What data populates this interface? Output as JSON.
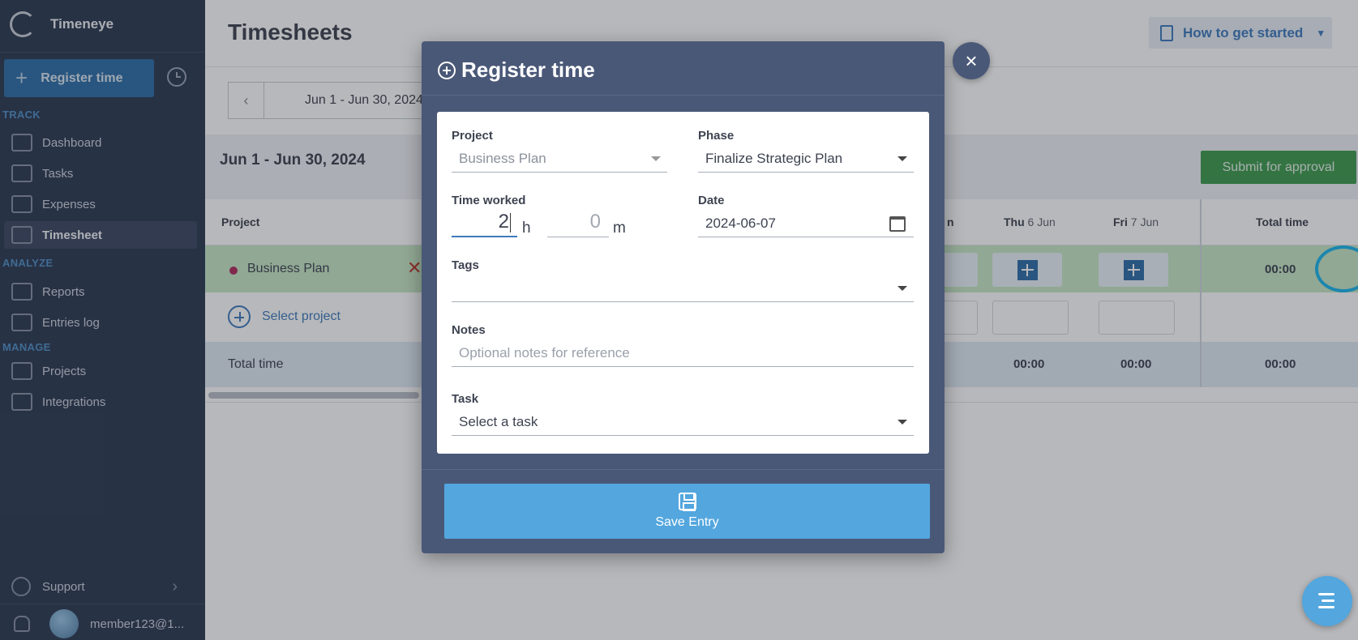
{
  "sidebar": {
    "brand": "Timeneye",
    "register_btn": "Register time",
    "sections": {
      "track": "TRACK",
      "analyze": "ANALYZE",
      "manage": "MANAGE"
    },
    "items": [
      {
        "label": "Dashboard"
      },
      {
        "label": "Tasks"
      },
      {
        "label": "Expenses"
      },
      {
        "label": "Timesheet"
      },
      {
        "label": "Reports"
      },
      {
        "label": "Entries log"
      },
      {
        "label": "Projects"
      },
      {
        "label": "Integrations"
      }
    ],
    "support": "Support",
    "user": "member123@1..."
  },
  "header": {
    "title": "Timesheets",
    "help_btn": "How to get started"
  },
  "range": {
    "picker": "Jun 1 - Jun 30, 2024",
    "label": "Jun 1 - Jun 30, 2024",
    "submit": "Submit for approval"
  },
  "table": {
    "col_project": "Project",
    "col_partial": "n",
    "col_thu": {
      "day": "Thu",
      "date": "6 Jun"
    },
    "col_fri": {
      "day": "Fri",
      "date": "7 Jun"
    },
    "col_total": "Total time",
    "row_project": "Business Plan",
    "row_total": "00:00",
    "select_project": "Select project",
    "total_label": "Total time",
    "totals": {
      "thu": "00:00",
      "fri": "00:00",
      "total": "00:00"
    }
  },
  "modal": {
    "title": "Register time",
    "project_label": "Project",
    "project_value": "Business Plan",
    "phase_label": "Phase",
    "phase_value": "Finalize Strategic Plan",
    "time_label": "Time worked",
    "hours": "2",
    "hours_unit": "h",
    "minutes_placeholder": "0",
    "minutes_unit": "m",
    "date_label": "Date",
    "date_value": "2024-06-07",
    "tags_label": "Tags",
    "notes_label": "Notes",
    "notes_placeholder": "Optional notes for reference",
    "task_label": "Task",
    "task_value": "Select a task",
    "save": "Save Entry",
    "close": "×"
  },
  "colors": {
    "sidebar": "#2d3a52",
    "modal": "#4a5878",
    "accent": "#53a6de",
    "submit": "#3e9b4f",
    "highlight": "#1bb6ec"
  }
}
